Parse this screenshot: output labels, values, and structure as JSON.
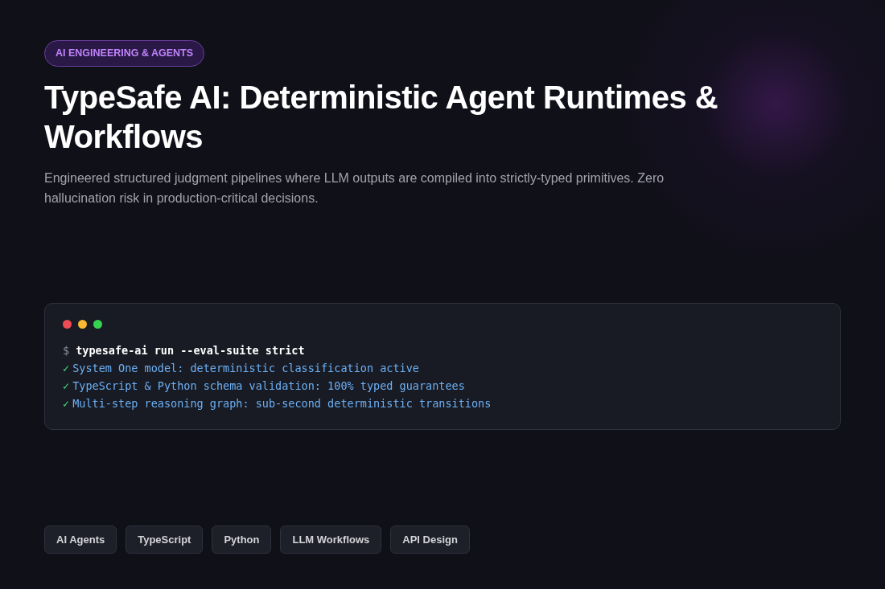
{
  "category": "AI ENGINEERING & AGENTS",
  "title": "TypeSafe AI: Deterministic Agent Runtimes & Workflows",
  "description": "Engineered structured judgment pipelines where LLM outputs are compiled into strictly-typed primitives. Zero hallucination risk in production-critical decisions.",
  "terminal": {
    "lines": [
      {
        "kind": "command",
        "marker": "$",
        "text": "typesafe-ai run --eval-suite strict"
      },
      {
        "kind": "check",
        "marker": "✓",
        "text": "System One model: deterministic classification active"
      },
      {
        "kind": "check",
        "marker": "✓",
        "text": "TypeScript & Python schema validation: 100% typed guarantees"
      },
      {
        "kind": "check",
        "marker": "✓",
        "text": "Multi-step reasoning graph: sub-second deterministic transitions"
      }
    ]
  },
  "tags": [
    "AI Agents",
    "TypeScript",
    "Python",
    "LLM Workflows",
    "API Design"
  ]
}
